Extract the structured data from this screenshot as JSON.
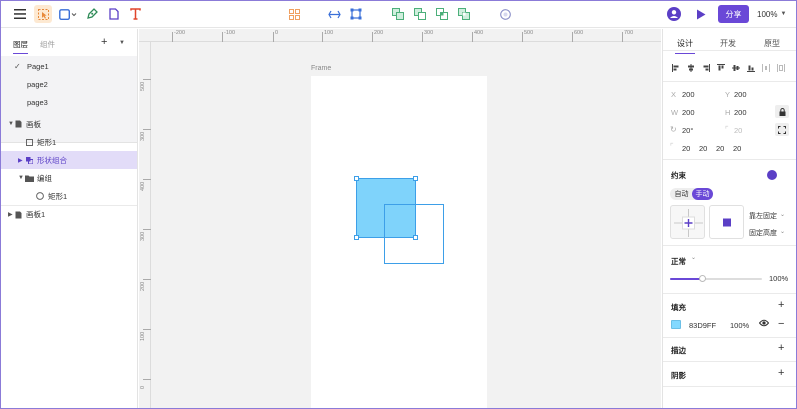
{
  "toolbar": {
    "share_label": "分享",
    "zoom_label": "100%"
  },
  "left_panel": {
    "tabs": [
      {
        "label": "图层"
      },
      {
        "label": "组件"
      }
    ],
    "add_symbol": "+",
    "pages": [
      {
        "label": "Page1",
        "checked": "✓"
      },
      {
        "label": "page2"
      },
      {
        "label": "page3"
      }
    ],
    "layers": [
      {
        "label": "画板"
      },
      {
        "label": "矩形1"
      },
      {
        "label": "形状组合"
      },
      {
        "label": "编组"
      },
      {
        "label": "矩形1"
      },
      {
        "label": "画板1"
      }
    ]
  },
  "canvas": {
    "frame_label": "Frame",
    "ruler_h": [
      "-200",
      "-100",
      "0",
      "100",
      "200",
      "300",
      "400",
      "500",
      "600",
      "700"
    ],
    "ruler_v": [
      "500",
      "300",
      "400",
      "300",
      "200",
      "100",
      "0"
    ],
    "shape_fill": "#7fd3fb",
    "shape_stroke": "#3d9fe8"
  },
  "right_panel": {
    "tabs": [
      {
        "label": "设计"
      },
      {
        "label": "开发"
      },
      {
        "label": "原型"
      }
    ],
    "x_label": "X",
    "x_value": "200",
    "y_label": "Y",
    "y_value": "200",
    "w_label": "W",
    "w_value": "200",
    "h_label": "H",
    "h_value": "200",
    "rotation_value": "20°",
    "radius_value": "20",
    "corner_values": [
      "20",
      "20",
      "20",
      "20"
    ],
    "constraints_title": "约束",
    "auto_label": "自动",
    "manual_label": "手动",
    "h_constraint": "靠左固定",
    "v_constraint": "固定高度",
    "blend_label": "正常",
    "opacity_value": "100%",
    "opacity_fraction": 0.35,
    "fill_title": "填充",
    "fill_hex": "83D9FF",
    "fill_opacity": "100%",
    "stroke_title": "描边",
    "shadow_title": "阴影",
    "plus_symbol": "+",
    "minus_symbol": "−",
    "accent": "#6a48d7"
  }
}
